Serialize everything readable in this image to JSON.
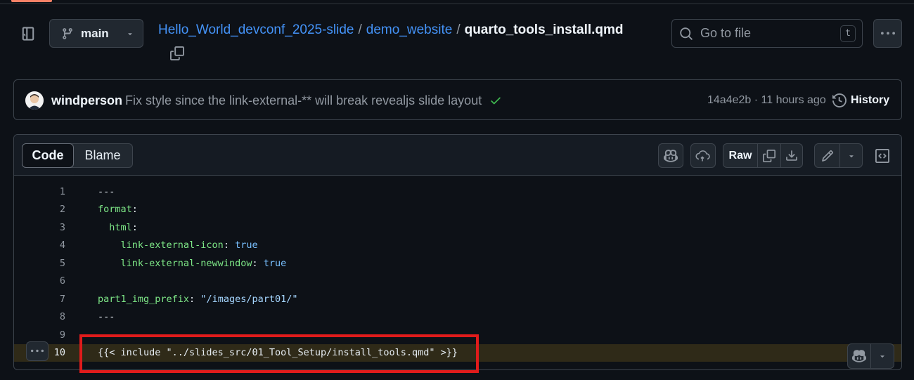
{
  "header": {
    "branch": "main",
    "breadcrumb": {
      "repo": "Hello_World_devconf_2025-slide",
      "sep1": "/",
      "folder": "demo_website",
      "sep2": "/",
      "file": "quarto_tools_install.qmd"
    },
    "search": {
      "placeholder": "Go to file",
      "shortcut": "t"
    }
  },
  "commit": {
    "author": "windperson",
    "message": "Fix style since the link-external-** will break revealjs slide layout",
    "meta": "14a4e2b · 11 hours ago",
    "history_label": "History"
  },
  "file_view": {
    "tabs": [
      {
        "label": "Code",
        "active": true
      },
      {
        "label": "Blame",
        "active": false
      }
    ],
    "raw_label": "Raw",
    "lines": [
      {
        "num": "1",
        "text": "---"
      },
      {
        "num": "2",
        "text": "format:"
      },
      {
        "num": "3",
        "text": "  html:"
      },
      {
        "num": "4",
        "text": "    link-external-icon: true"
      },
      {
        "num": "5",
        "text": "    link-external-newwindow: true"
      },
      {
        "num": "6",
        "text": ""
      },
      {
        "num": "7",
        "text": "part1_img_prefix: \"/images/part01/\""
      },
      {
        "num": "8",
        "text": "---"
      },
      {
        "num": "9",
        "text": ""
      },
      {
        "num": "10",
        "text": "{{< include \"../slides_src/01_Tool_Setup/install_tools.qmd\" >}}"
      }
    ]
  },
  "colors": {
    "background": "#0d1117",
    "link": "#4493f8",
    "yaml_key": "#7ee787",
    "yaml_value": "#79c0ff",
    "annotation_box": "#e01b1b",
    "success_check": "#3fb950"
  }
}
